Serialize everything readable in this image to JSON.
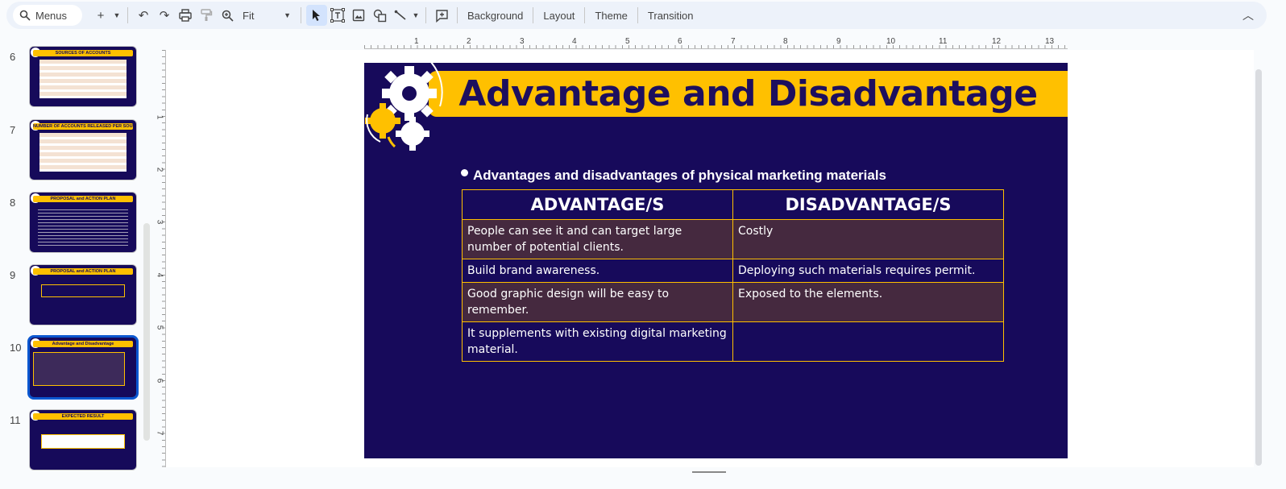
{
  "toolbar": {
    "search_placeholder": "Menus",
    "zoom": "Fit",
    "background": "Background",
    "layout": "Layout",
    "theme": "Theme",
    "transition": "Transition"
  },
  "ruler": {
    "top": [
      "1",
      "2",
      "3",
      "4",
      "5",
      "6",
      "7",
      "8",
      "9",
      "10",
      "11",
      "12",
      "13"
    ],
    "left": [
      "1",
      "2",
      "3",
      "4",
      "5",
      "6",
      "7"
    ]
  },
  "filmstrip": [
    {
      "num": "6",
      "title": "SOURCES OF ACCOUNTS"
    },
    {
      "num": "7",
      "title": "NUMBER OF ACCOUNTS RELEASED PER SOURCE"
    },
    {
      "num": "8",
      "title": "PROPOSAL and ACTION PLAN"
    },
    {
      "num": "9",
      "title": "PROPOSAL and ACTION PLAN"
    },
    {
      "num": "10",
      "title": "Advantage and Disadvantage"
    },
    {
      "num": "11",
      "title": "EXPECTED RESULT"
    }
  ],
  "slide": {
    "title": "Advantage and Disadvantage",
    "bullet": "Advantages and disadvantages of physical marketing materials",
    "headers": [
      "ADVANTAGE/S",
      "DISADVANTAGE/S"
    ],
    "rows": [
      [
        "People can see it and can target large number of potential clients.",
        "Costly"
      ],
      [
        "Build brand awareness.",
        "Deploying such materials requires permit."
      ],
      [
        "Good graphic design will be easy to remember.",
        "Exposed to the elements."
      ],
      [
        "It supplements with existing digital marketing material.",
        ""
      ]
    ]
  },
  "colors": {
    "slide_bg": "#170a5b",
    "accent": "#ffc000",
    "title_text": "#1d0f5e",
    "row_shade": "#45293f",
    "selection": "#0b57d0"
  }
}
